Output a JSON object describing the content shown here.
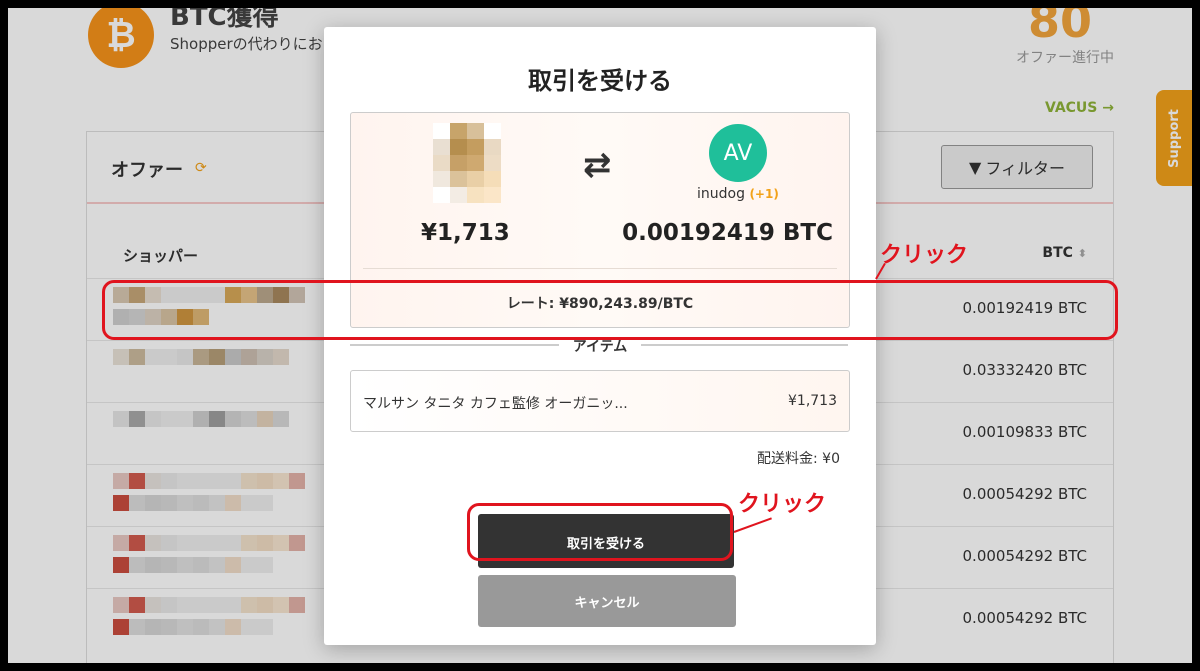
{
  "page": {
    "title": "BTC獲得",
    "subtitle": "Shopperの代わりにお",
    "offer_count": "80",
    "offer_count_label": "オファー進行中",
    "vacus_link": "VACUS →",
    "support_tab": "Support"
  },
  "panel": {
    "title": "オファー",
    "filter_label": "フィルター",
    "col_shopper": "ショッパー",
    "col_btc": "BTC",
    "rows": [
      {
        "amount": "0.00192419 BTC"
      },
      {
        "amount": "0.03332420 BTC"
      },
      {
        "amount": "0.00109833 BTC"
      },
      {
        "amount": "0.00054292 BTC"
      },
      {
        "amount": "0.00054292 BTC"
      },
      {
        "amount": "0.00054292 BTC"
      }
    ]
  },
  "modal": {
    "title": "取引を受ける",
    "jpy_amount": "¥1,713",
    "btc_amount": "0.00192419 BTC",
    "avatar_initials": "AV",
    "user_name": "inudog",
    "user_plus": "(+1)",
    "rate": "レート: ¥890,243.89/BTC",
    "items_label": "アイテム",
    "item_name": "マルサン タニタ カフェ監修 オーガニッ...",
    "item_price": "¥1,713",
    "shipping": "配送料金: ¥0",
    "accept_label": "取引を受ける",
    "cancel_label": "キャンセル"
  },
  "annotations": {
    "click_1": "クリック",
    "click_2": "クリック"
  },
  "colors": {
    "accent_orange": "#f2a21a",
    "annotation_red": "#e0141e",
    "avatar_green": "#1fbf9a"
  }
}
